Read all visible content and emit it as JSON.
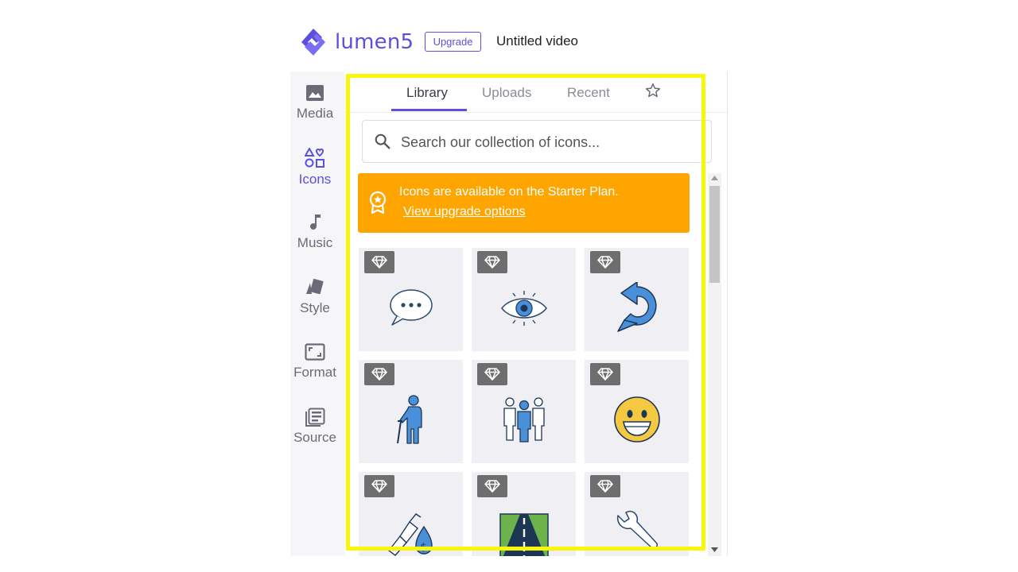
{
  "header": {
    "logo_text": "lumen5",
    "upgrade_label": "Upgrade",
    "video_title": "Untitled video"
  },
  "sidebar": {
    "items": [
      {
        "label": "Media",
        "icon": "image-icon"
      },
      {
        "label": "Icons",
        "icon": "shapes-icon",
        "active": true
      },
      {
        "label": "Music",
        "icon": "music-note-icon"
      },
      {
        "label": "Style",
        "icon": "style-cards-icon"
      },
      {
        "label": "Format",
        "icon": "format-frame-icon"
      },
      {
        "label": "Source",
        "icon": "source-list-icon"
      }
    ]
  },
  "panel": {
    "tabs": [
      {
        "label": "Library",
        "active": true
      },
      {
        "label": "Uploads"
      },
      {
        "label": "Recent"
      },
      {
        "icon": "star-icon"
      }
    ],
    "search": {
      "placeholder": "Search our collection of icons..."
    },
    "banner": {
      "message": "Icons are available on the Starter Plan.",
      "link": "View upgrade options",
      "icon": "award-ribbon-icon",
      "color": "#ffa500"
    },
    "icons": [
      {
        "name": "speech-bubble-icon",
        "premium": true
      },
      {
        "name": "eye-icon",
        "premium": true
      },
      {
        "name": "redo-arrow-icon",
        "premium": true
      },
      {
        "name": "elderly-person-icon",
        "premium": true
      },
      {
        "name": "group-people-icon",
        "premium": true
      },
      {
        "name": "smiley-face-icon",
        "premium": true
      },
      {
        "name": "fuel-pump-dollar-icon",
        "premium": true
      },
      {
        "name": "road-icon",
        "premium": true
      },
      {
        "name": "wrench-icon",
        "premium": true
      }
    ]
  },
  "colors": {
    "accent": "#5b4fe0",
    "banner": "#ffa500",
    "highlight": "#f8f60b",
    "icon_blue": "#4a90d9"
  }
}
